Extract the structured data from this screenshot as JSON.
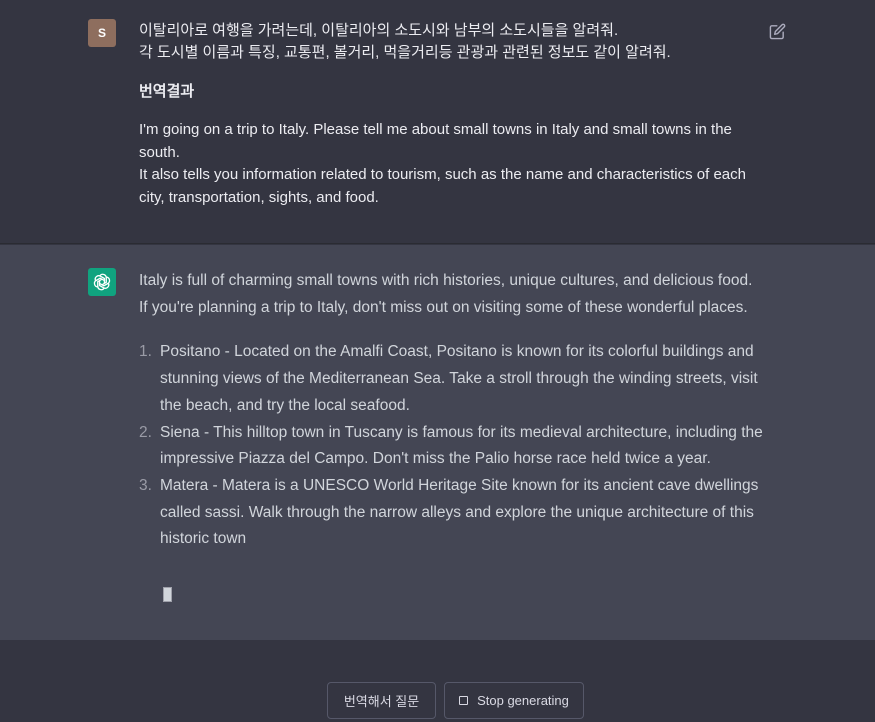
{
  "colors": {
    "page_bg": "#343541",
    "assistant_bg": "#444654",
    "user_avatar_bg": "#8e6e5e",
    "assistant_avatar_bg": "#10a37f"
  },
  "user_message": {
    "avatar_initial": "S",
    "lines": [
      "이탈리아로 여행을 가려는데, 이탈리아의 소도시와 남부의 소도시들을 알려줘.",
      "각 도시별 이름과 특징, 교통편, 볼거리, 먹을거리등 관광과 관련된 정보도 같이 알려줘."
    ],
    "translated_heading": "번역결과",
    "translation": [
      "I'm going on a trip to Italy. Please tell me about small towns in Italy and small towns in the south.",
      "It also tells you information related to tourism, such as the name and characteristics of each city, transportation, sights, and food."
    ],
    "edit_icon": "edit-icon"
  },
  "assistant_message": {
    "avatar_icon": "openai-logo-icon",
    "intro": "Italy is full of charming small towns with rich histories, unique cultures, and delicious food. If you're planning a trip to Italy, don't miss out on visiting some of these wonderful places.",
    "items": [
      {
        "number": "1.",
        "text": "Positano - Located on the Amalfi Coast, Positano is known for its colorful buildings and stunning views of the Mediterranean Sea. Take a stroll through the winding streets, visit the beach, and try the local seafood."
      },
      {
        "number": "2.",
        "text": "Siena - This hilltop town in Tuscany is famous for its medieval architecture, including the impressive Piazza del Campo. Don't miss the Palio horse race held twice a year."
      },
      {
        "number": "3.",
        "text": "Matera - Matera is a UNESCO World Heritage Site known for its ancient cave dwellings called sassi. Walk through the narrow alleys and explore the unique architecture of this historic town"
      }
    ]
  },
  "actions": {
    "translate_ask_label": "번역해서 질문",
    "stop_label": "Stop generating",
    "stop_icon": "square-stop-icon"
  }
}
